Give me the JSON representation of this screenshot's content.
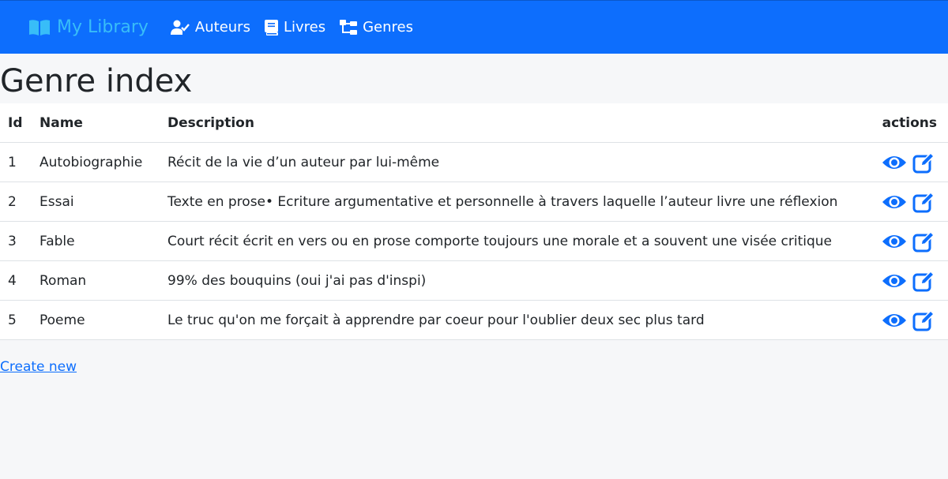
{
  "nav": {
    "brand": "My Library",
    "links": [
      "Auteurs",
      "Livres",
      "Genres"
    ]
  },
  "page": {
    "title": "Genre index"
  },
  "table": {
    "headers": [
      "Id",
      "Name",
      "Description",
      "actions"
    ],
    "rows": [
      {
        "id": "1",
        "name": "Autobiographie",
        "description": "Récit de la vie d’un auteur par lui-même"
      },
      {
        "id": "2",
        "name": "Essai",
        "description": "Texte en prose• Ecriture argumentative et personnelle à travers laquelle l’auteur livre une réflexion"
      },
      {
        "id": "3",
        "name": "Fable",
        "description": "Court récit écrit en vers ou en prose comporte toujours une morale et a souvent une visée critique"
      },
      {
        "id": "4",
        "name": "Roman",
        "description": "99% des bouquins (oui j'ai pas d'inspi)"
      },
      {
        "id": "5",
        "name": "Poeme",
        "description": "Le truc qu'on me forçait à apprendre par coeur pour l'oublier deux sec plus tard"
      }
    ]
  },
  "create_link": "Create new",
  "icons": {
    "brand": "book-open-icon",
    "authors": "user-check-icon",
    "books": "book-icon",
    "genres": "sitemap-icon",
    "view": "eye-icon",
    "edit": "edit-icon"
  },
  "colors": {
    "navbar": "#0d6efd",
    "brand": "#38bdf8",
    "action_icon": "#0d6efd"
  }
}
